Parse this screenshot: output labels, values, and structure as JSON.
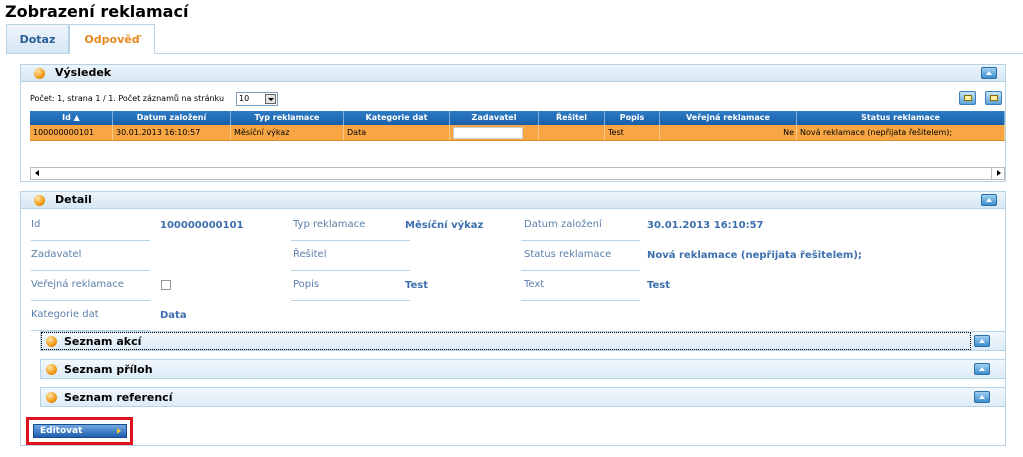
{
  "page": {
    "title": "Zobrazení reklamací"
  },
  "tabs": [
    {
      "label": "Dotaz",
      "active": false
    },
    {
      "label": "Odpověď",
      "active": true
    }
  ],
  "result_panel": {
    "title": "Výsledek",
    "paging_text": "Počet: 1, strana 1 / 1. Počet záznamů na stránku",
    "page_size": "10",
    "columns": [
      "Id ▲",
      "Datum založení",
      "Typ reklamace",
      "Kategorie dat",
      "Zadavatel",
      "Řešitel",
      "Popis",
      "Veřejná reklamace",
      "Status reklamace"
    ],
    "rows": [
      {
        "id": "100000000101",
        "datum": "30.01.2013 16:10:57",
        "typ": "Měsíční výkaz",
        "kategorie": "Data",
        "zadavatel": "",
        "resitel": "",
        "popis": "Test",
        "verejna": "Ne",
        "status": "Nová reklamace (nepřijata řešitelem);"
      }
    ]
  },
  "detail_panel": {
    "title": "Detail",
    "fields": {
      "id": {
        "label": "Id",
        "value": "100000000101"
      },
      "typ": {
        "label": "Typ reklamace",
        "value": "Měsíční výkaz"
      },
      "datum": {
        "label": "Datum založení",
        "value": "30.01.2013 16:10:57"
      },
      "zadavatel": {
        "label": "Zadavatel",
        "value": ""
      },
      "resitel": {
        "label": "Řešitel",
        "value": ""
      },
      "status": {
        "label": "Status reklamace",
        "value": "Nová reklamace (nepřijata řešitelem);"
      },
      "verejna": {
        "label": "Veřejná reklamace",
        "checked": false
      },
      "popis": {
        "label": "Popis",
        "value": "Test"
      },
      "text": {
        "label": "Text",
        "value": "Test"
      },
      "kategorie": {
        "label": "Kategorie dat",
        "value": "Data"
      }
    },
    "sections": [
      "Seznam akcí",
      "Seznam příloh",
      "Seznam referencí"
    ],
    "edit_label": "Editovat"
  },
  "colors": {
    "header_blue": "#1a5ea8",
    "selected_row": "#f7a643",
    "label_blue": "#5b7faa",
    "value_blue": "#3d6fae",
    "active_tab": "#e8881c",
    "highlight_red": "#e0101d"
  },
  "icons": [
    "orange-ball-icon",
    "collapse-up-icon",
    "export-icon",
    "print-icon",
    "scroll-left-icon",
    "scroll-right-icon",
    "dropdown-arrow-icon",
    "sort-asc-icon"
  ]
}
